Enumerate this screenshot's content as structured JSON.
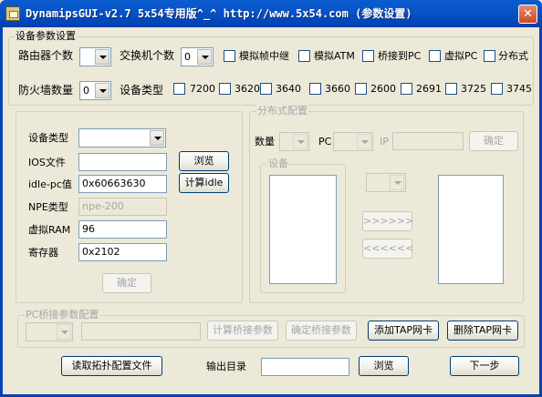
{
  "window": {
    "title": "DynamipsGUI-v2.7   5x54专用版^_^ http://www.5x54.com   (参数设置)",
    "close_glyph": "✕"
  },
  "device_params": {
    "group_title": "设备参数设置",
    "router_count_label": "路由器个数",
    "router_count_value": "",
    "switch_count_label": "交换机个数",
    "switch_count_value": "0",
    "options": [
      {
        "label": "模拟帧中继",
        "checked": false
      },
      {
        "label": "模拟ATM",
        "checked": false
      },
      {
        "label": "桥接到PC",
        "checked": false
      },
      {
        "label": "虚拟PC",
        "checked": false
      },
      {
        "label": "分布式",
        "checked": false
      }
    ],
    "firewall_count_label": "防火墙数量",
    "firewall_count_value": "0",
    "device_type_label": "设备类型",
    "device_types": [
      {
        "label": "7200",
        "checked": false
      },
      {
        "label": "3620",
        "checked": false
      },
      {
        "label": "3640",
        "checked": false
      },
      {
        "label": "3660",
        "checked": false
      },
      {
        "label": "2600",
        "checked": false
      },
      {
        "label": "2691",
        "checked": false
      },
      {
        "label": "3725",
        "checked": false
      },
      {
        "label": "3745",
        "checked": false
      }
    ]
  },
  "router_config": {
    "device_type_label": "设备类型",
    "device_type_value": "",
    "ios_label": "IOS文件",
    "ios_value": "",
    "browse_label": "浏览",
    "idle_label": "idle-pc值",
    "idle_value": "0x60663630",
    "calc_idle_label": "计算idle",
    "npe_label": "NPE类型",
    "npe_value": "npe-200",
    "ram_label": "虚拟RAM",
    "ram_value": "96",
    "register_label": "寄存器",
    "register_value": "0x2102",
    "confirm_label": "确定"
  },
  "distributed_config": {
    "group_title": "分布式配置",
    "count_label": "数量",
    "pc_label": "PC",
    "ip_label": "IP",
    "ip_value": "",
    "confirm_label": "确定",
    "device_group_title": "设备",
    "move_right_label": ">>>>>>",
    "move_left_label": "<<<<<<"
  },
  "bridge_config": {
    "group_title": "PC桥接参数配置",
    "calc_bridge_label": "计算桥接参数",
    "confirm_bridge_label": "确定桥接参数",
    "add_tap_label": "添加TAP网卡",
    "remove_tap_label": "删除TAP网卡"
  },
  "footer": {
    "read_topology_label": "读取拓扑配置文件",
    "output_dir_label": "输出目录",
    "output_dir_value": "",
    "browse_label": "浏览",
    "next_label": "下一步"
  }
}
